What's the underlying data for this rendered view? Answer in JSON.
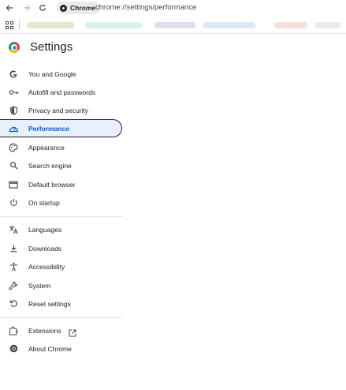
{
  "browser": {
    "chip_label": "Chrome",
    "url": "chrome://settings/performance",
    "back_icon": "back-arrow-icon",
    "forward_icon": "forward-arrow-icon",
    "reload_icon": "reload-icon"
  },
  "header": {
    "title": "Settings"
  },
  "sidebar": {
    "items": [
      {
        "label": "You and Google",
        "icon": "google-g-icon"
      },
      {
        "label": "Autofill and passwords",
        "icon": "key-icon"
      },
      {
        "label": "Privacy and security",
        "icon": "shield-icon"
      },
      {
        "label": "Performance",
        "icon": "speedometer-icon",
        "active": true
      },
      {
        "label": "Appearance",
        "icon": "palette-icon"
      },
      {
        "label": "Search engine",
        "icon": "search-icon"
      },
      {
        "label": "Default browser",
        "icon": "browser-window-icon"
      },
      {
        "label": "On startup",
        "icon": "power-icon"
      },
      {
        "label": "Languages",
        "icon": "translate-icon"
      },
      {
        "label": "Downloads",
        "icon": "download-icon"
      },
      {
        "label": "Accessibility",
        "icon": "accessibility-icon"
      },
      {
        "label": "System",
        "icon": "wrench-icon"
      },
      {
        "label": "Reset settings",
        "icon": "reset-icon"
      },
      {
        "label": "Extensions",
        "icon": "puzzle-icon"
      },
      {
        "label": "About Chrome",
        "icon": "chrome-logo-icon"
      }
    ]
  },
  "colors": {
    "accent": "#0b57d0",
    "active_bg": "#e8f0fe"
  }
}
